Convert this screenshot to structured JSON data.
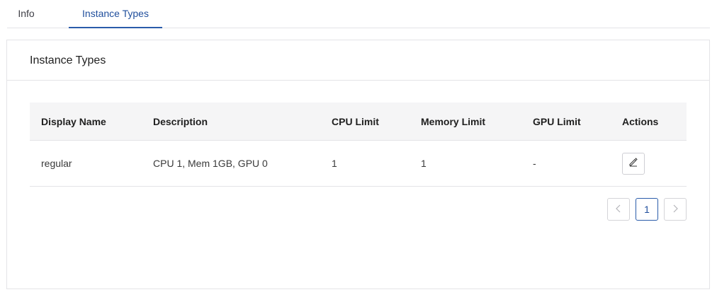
{
  "tabs": [
    {
      "label": "Info",
      "active": false
    },
    {
      "label": "Instance Types",
      "active": true
    }
  ],
  "card": {
    "title": "Instance Types"
  },
  "table": {
    "columns": [
      "Display Name",
      "Description",
      "CPU Limit",
      "Memory Limit",
      "GPU Limit",
      "Actions"
    ],
    "rows": [
      {
        "display_name": "regular",
        "description": "CPU 1, Mem 1GB, GPU 0",
        "cpu_limit": "1",
        "memory_limit": "1",
        "gpu_limit": "-",
        "action_icon": "edit-icon"
      }
    ]
  },
  "pagination": {
    "current_page": "1",
    "prev_icon": "chevron-left-icon",
    "next_icon": "chevron-right-icon"
  },
  "colors": {
    "accent": "#2a5caa",
    "header_bg": "#f5f5f6",
    "border": "#e4e4e7"
  }
}
